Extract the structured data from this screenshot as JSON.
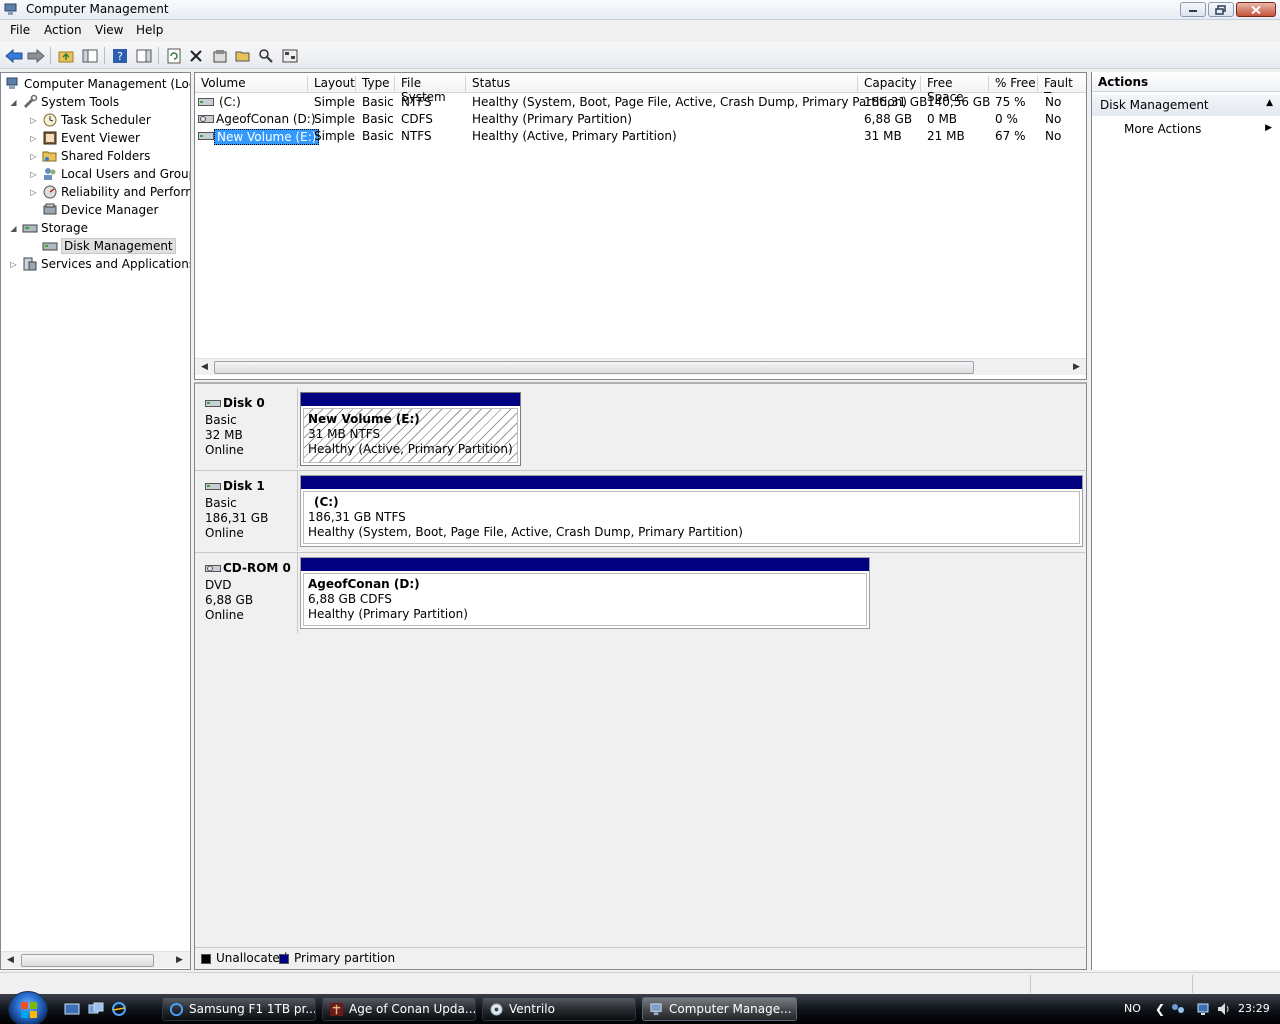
{
  "window": {
    "title": "Computer Management",
    "min_icon": "minimize-icon",
    "max_icon": "restore-icon",
    "close_icon": "close-icon"
  },
  "menu": {
    "file": "File",
    "action": "Action",
    "view": "View",
    "help": "Help"
  },
  "toolbar": {
    "icons": [
      "back-arrow-icon",
      "forward-arrow-icon",
      "up-folder-icon",
      "show-hide-tree-icon",
      "help-icon",
      "show-hide-action-pane-icon",
      "refresh-icon",
      "delete-icon",
      "properties-icon",
      "open-icon",
      "rescan-icon",
      "settings-icon"
    ]
  },
  "tree": {
    "root": "Computer Management (Local",
    "system_tools": "System Tools",
    "task_scheduler": "Task Scheduler",
    "event_viewer": "Event Viewer",
    "shared_folders": "Shared Folders",
    "local_users": "Local Users and Groups",
    "reliability": "Reliability and Performa",
    "device_manager": "Device Manager",
    "storage": "Storage",
    "disk_management": "Disk Management",
    "services": "Services and Applications"
  },
  "volume_list": {
    "columns": [
      "Volume",
      "Layout",
      "Type",
      "File System",
      "Status",
      "Capacity",
      "Free Space",
      "% Free",
      "Fault To"
    ],
    "rows": [
      {
        "volume": "(C:)",
        "layout": "Simple",
        "type": "Basic",
        "fs": "NTFS",
        "status": "Healthy (System, Boot, Page File, Active, Crash Dump, Primary Partition)",
        "capacity": "186,31 GB",
        "free": "140,56 GB",
        "pct": "75 %",
        "fault": "No"
      },
      {
        "volume": "AgeofConan (D:)",
        "layout": "Simple",
        "type": "Basic",
        "fs": "CDFS",
        "status": "Healthy (Primary Partition)",
        "capacity": "6,88 GB",
        "free": "0 MB",
        "pct": "0 %",
        "fault": "No"
      },
      {
        "volume": "New Volume (E:)",
        "layout": "Simple",
        "type": "Basic",
        "fs": "NTFS",
        "status": "Healthy (Active, Primary Partition)",
        "capacity": "31 MB",
        "free": "21 MB",
        "pct": "67 %",
        "fault": "No"
      }
    ]
  },
  "disks": [
    {
      "name": "Disk 0",
      "type": "Basic",
      "size": "32 MB",
      "state": "Online",
      "partition": {
        "name": "New Volume  (E:)",
        "size": "31 MB NTFS",
        "status": "Healthy (Active, Primary Partition)"
      }
    },
    {
      "name": "Disk 1",
      "type": "Basic",
      "size": "186,31 GB",
      "state": "Online",
      "partition": {
        "name": "(C:)",
        "size": "186,31 GB NTFS",
        "status": "Healthy (System, Boot, Page File, Active, Crash Dump, Primary Partition)"
      }
    },
    {
      "name": "CD-ROM 0",
      "type": "DVD",
      "size": "6,88 GB",
      "state": "Online",
      "partition": {
        "name": "AgeofConan  (D:)",
        "size": "6,88 GB CDFS",
        "status": "Healthy (Primary Partition)"
      }
    }
  ],
  "legend": {
    "unallocated": "Unallocated",
    "primary": "Primary partition",
    "unallocated_color": "#000000",
    "primary_color": "#000080"
  },
  "actions": {
    "header": "Actions",
    "section": "Disk Management",
    "more": "More Actions"
  },
  "taskbar": {
    "items": [
      {
        "label": "Samsung F1 1TB pr...",
        "icon": "ie-icon"
      },
      {
        "label": "Age of Conan Upda...",
        "icon": "aoc-icon"
      },
      {
        "label": "Ventrilo",
        "icon": "ventrilo-icon"
      },
      {
        "label": "Computer Manage...",
        "icon": "computer-management-icon"
      }
    ],
    "lang": "NO",
    "clock": "23:29"
  }
}
